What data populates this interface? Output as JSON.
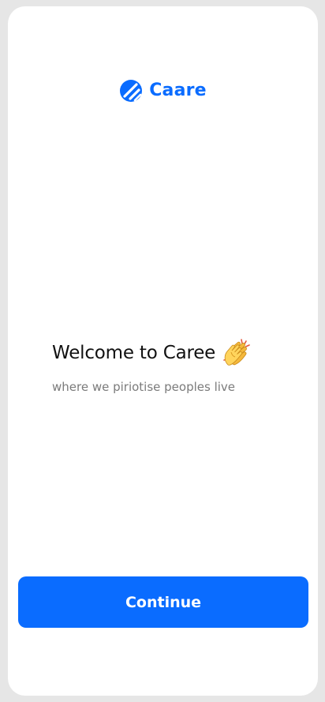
{
  "colors": {
    "brand": "#0a6cff",
    "background": "#ffffff",
    "title": "#111111",
    "subtitle": "#7b7b7b"
  },
  "logo": {
    "icon": "caare-logo-icon",
    "name": "Caare"
  },
  "welcome": {
    "title": "Welcome to Caree",
    "emoji_icon": "clapping-hands-icon",
    "subtitle": "where we piriotise peoples live"
  },
  "actions": {
    "continue_label": "Continue"
  }
}
